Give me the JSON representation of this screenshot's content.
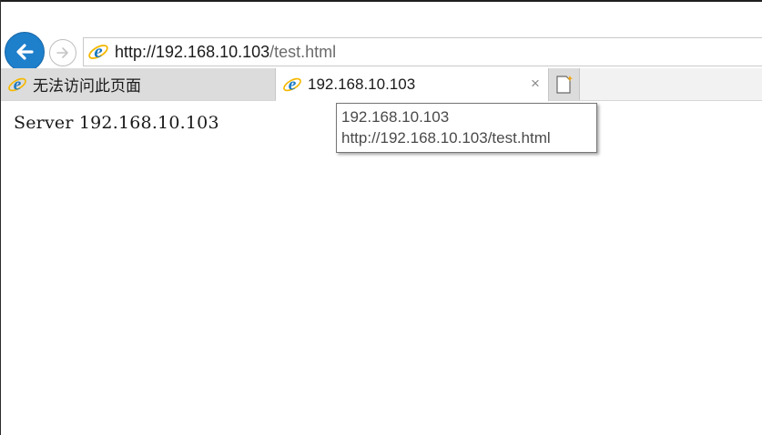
{
  "browser": {
    "address_bar": {
      "url_domain": "http://192.168.10.103",
      "url_path": "/test.html"
    },
    "tabs": [
      {
        "label": "无法访问此页面",
        "active": false
      },
      {
        "label": "192.168.10.103",
        "active": true,
        "close_glyph": "×"
      }
    ],
    "icons": {
      "back": "back-arrow-icon",
      "forward": "forward-arrow-icon",
      "site": "ie-icon",
      "new_tab": "new-tab-icon"
    },
    "colors": {
      "back_button": "#1e7fcb",
      "ie_blue": "#1a78c2",
      "ie_ring": "#f5b800"
    }
  },
  "page": {
    "content_text": "Server 192.168.10.103"
  },
  "tooltip": {
    "title": "192.168.10.103",
    "url": "http://192.168.10.103/test.html"
  }
}
